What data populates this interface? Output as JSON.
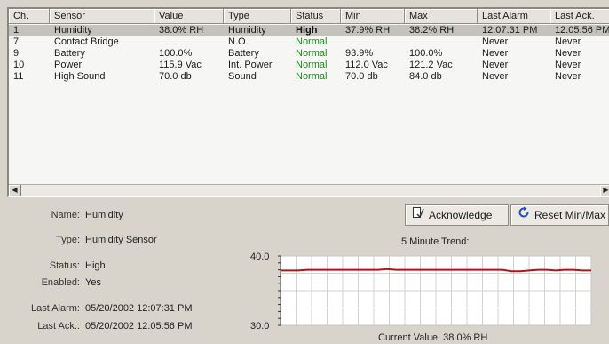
{
  "table": {
    "columns": [
      "Ch.",
      "Sensor",
      "Value",
      "Type",
      "Status",
      "Min",
      "Max",
      "Last Alarm",
      "Last Ack."
    ],
    "rows": [
      {
        "ch": "1",
        "sensor": "Humidity",
        "value": "38.0% RH",
        "type": "Humidity",
        "status": "High",
        "min": "37.9% RH",
        "max": "38.2% RH",
        "last_alarm": "12:07:31 PM",
        "last_ack": "12:05:56 PM",
        "selected": true
      },
      {
        "ch": "7",
        "sensor": "Contact Bridge",
        "value": "",
        "type": "N.O.",
        "status": "Normal",
        "min": "",
        "max": "",
        "last_alarm": "Never",
        "last_ack": "Never",
        "selected": false
      },
      {
        "ch": "9",
        "sensor": "Battery",
        "value": "100.0%",
        "type": "Battery",
        "status": "Normal",
        "min": "93.9%",
        "max": "100.0%",
        "last_alarm": "Never",
        "last_ack": "Never",
        "selected": false
      },
      {
        "ch": "10",
        "sensor": "Power",
        "value": "115.9 Vac",
        "type": "Int. Power",
        "status": "Normal",
        "min": "112.0 Vac",
        "max": "121.2 Vac",
        "last_alarm": "Never",
        "last_ack": "Never",
        "selected": false
      },
      {
        "ch": "11",
        "sensor": "High Sound",
        "value": "70.0 db",
        "type": "Sound",
        "status": "Normal",
        "min": "70.0 db",
        "max": "84.0 db",
        "last_alarm": "Never",
        "last_ack": "Never",
        "selected": false
      }
    ]
  },
  "details": {
    "name_label": "Name:",
    "name_value": "Humidity",
    "type_label": "Type:",
    "type_value": "Humidity Sensor",
    "status_label": "Status:",
    "status_value": "High",
    "enabled_label": "Enabled:",
    "enabled_value": "Yes",
    "last_alarm_label": "Last Alarm:",
    "last_alarm_value": "05/20/2002 12:07:31 PM",
    "last_ack_label": "Last Ack.:",
    "last_ack_value": "05/20/2002 12:05:56 PM"
  },
  "buttons": {
    "acknowledge": "Acknowledge",
    "reset": "Reset Min/Max",
    "acknowledge_icon": "acknowledge-icon",
    "reset_icon": "refresh-icon"
  },
  "chart_data": {
    "type": "line",
    "title": "5 Minute Trend:",
    "y_top_label": "40.0",
    "y_bottom_label": "30.0",
    "ylim": [
      30.0,
      40.0
    ],
    "current_value": "Current Value: 38.0% RH",
    "grid": true,
    "series": [
      {
        "values": [
          37.9,
          37.9,
          37.9,
          38.0,
          38.0,
          38.0,
          38.0,
          38.0,
          38.0,
          38.0,
          38.0,
          38.0,
          38.1,
          38.0,
          38.0,
          38.0,
          38.0,
          38.0,
          38.0,
          38.0,
          38.0,
          38.0,
          38.0,
          38.0,
          38.0,
          38.0,
          37.8,
          37.8,
          37.9,
          38.0,
          38.0,
          37.9,
          38.0,
          38.0,
          37.9,
          37.9
        ]
      }
    ]
  },
  "colors": {
    "trend_line": "#b01515",
    "status_normal": "#1b8a1b",
    "panel_bg": "#d8d4cc"
  }
}
